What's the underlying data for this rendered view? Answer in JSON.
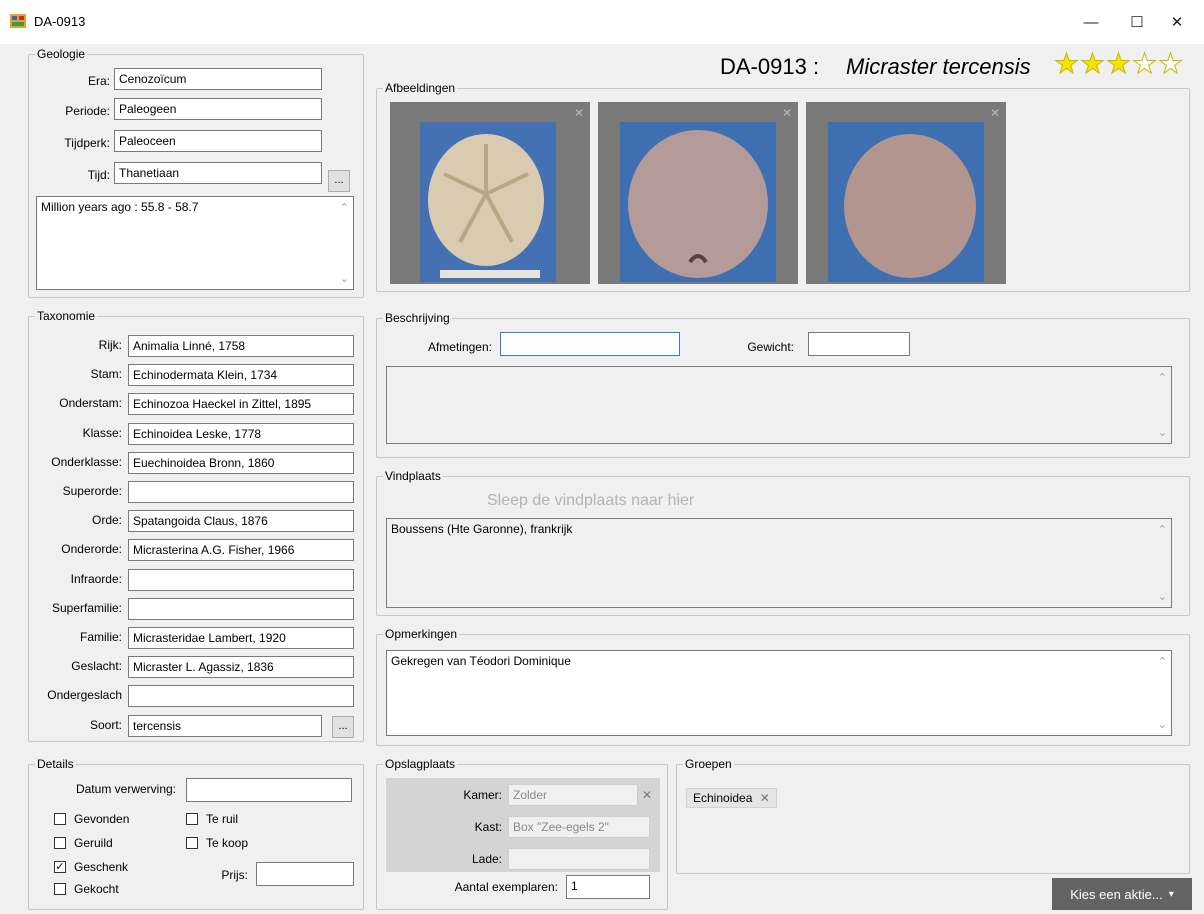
{
  "window": {
    "title": "DA-0913",
    "minimize": "—",
    "maximize": "☐",
    "close": "✕"
  },
  "header": {
    "id_prefix": "DA-0913 :",
    "species": "Micraster tercensis",
    "rating": 3,
    "rating_max": 5
  },
  "geologie": {
    "label": "Geologie",
    "era_label": "Era:",
    "era": "Cenozoïcum",
    "periode_label": "Periode:",
    "periode": "Paleogeen",
    "tijdperk_label": "Tijdperk:",
    "tijdperk": "Paleoceen",
    "tijd_label": "Tijd:",
    "tijd": "Thanetiaan",
    "browse": "...",
    "info": "Million years ago : 55.8 - 58.7"
  },
  "afbeeldingen": {
    "label": "Afbeeldingen",
    "remove": "✕"
  },
  "taxonomie": {
    "label": "Taxonomie",
    "rows": [
      {
        "label": "Rijk:",
        "value": "Animalia Linné, 1758"
      },
      {
        "label": "Stam:",
        "value": "Echinodermata Klein, 1734"
      },
      {
        "label": "Onderstam:",
        "value": "Echinozoa Haeckel in Zittel, 1895"
      },
      {
        "label": "Klasse:",
        "value": "Echinoidea Leske, 1778"
      },
      {
        "label": "Onderklasse:",
        "value": "Euechinoidea Bronn, 1860"
      },
      {
        "label": "Superorde:",
        "value": ""
      },
      {
        "label": "Orde:",
        "value": "Spatangoida Claus, 1876"
      },
      {
        "label": "Onderorde:",
        "value": "Micrasterina A.G. Fisher, 1966"
      },
      {
        "label": "Infraorde:",
        "value": ""
      },
      {
        "label": "Superfamilie:",
        "value": ""
      },
      {
        "label": "Familie:",
        "value": "Micrasteridae Lambert, 1920"
      },
      {
        "label": "Geslacht:",
        "value": "Micraster L. Agassiz, 1836"
      },
      {
        "label": "Ondergeslach",
        "value": ""
      },
      {
        "label": "Soort:",
        "value": "tercensis"
      }
    ],
    "browse": "..."
  },
  "beschrijving": {
    "label": "Beschrijving",
    "afmetingen_label": "Afmetingen:",
    "afmetingen": "",
    "gewicht_label": "Gewicht:",
    "gewicht": "",
    "text": ""
  },
  "vindplaats": {
    "label": "Vindplaats",
    "drop_hint": "Sleep de vindplaats naar hier",
    "text": "Boussens (Hte Garonne), frankrijk"
  },
  "opmerkingen": {
    "label": "Opmerkingen",
    "text": "Gekregen van Téodori Dominique"
  },
  "details": {
    "label": "Details",
    "datum_label": "Datum verwerving:",
    "datum": "",
    "checks": [
      {
        "label": "Gevonden",
        "checked": false
      },
      {
        "label": "Geruild",
        "checked": false
      },
      {
        "label": "Geschenk",
        "checked": true
      },
      {
        "label": "Gekocht",
        "checked": false
      },
      {
        "label": "Te ruil",
        "checked": false
      },
      {
        "label": "Te koop",
        "checked": false
      }
    ],
    "check_mark": "✓",
    "prijs_label": "Prijs:",
    "prijs": ""
  },
  "opslagplaats": {
    "label": "Opslagplaats",
    "kamer_label": "Kamer:",
    "kamer": "Zolder",
    "clear": "✕",
    "kast_label": "Kast:",
    "kast": "Box \"Zee-egels 2\"",
    "lade_label": "Lade:",
    "lade": "",
    "aantal_label": "Aantal exemplaren:",
    "aantal": "1"
  },
  "groepen": {
    "label": "Groepen",
    "chip": "Echinoidea",
    "chip_remove": "✕"
  },
  "action_button": {
    "label": "Kies een aktie...",
    "arrow": "▾"
  },
  "colors": {
    "star": "#f5e400",
    "star_empty": "#ffffff",
    "photo_bg": "#3e6fb0",
    "thumb_frame": "#7a7a7a"
  }
}
